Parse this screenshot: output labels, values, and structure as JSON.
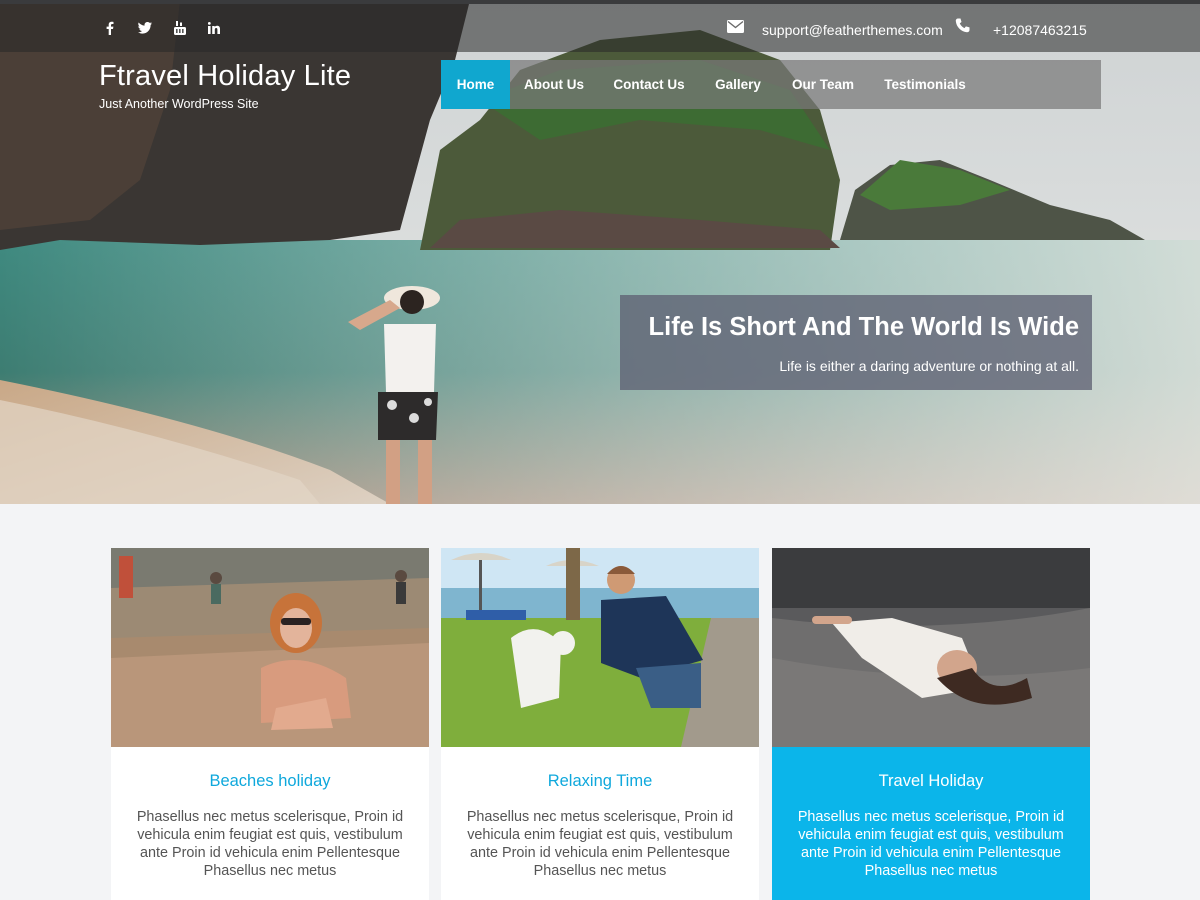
{
  "header": {
    "social": [
      {
        "name": "facebook-icon",
        "glyph": "f"
      },
      {
        "name": "twitter-icon",
        "glyph": "t"
      },
      {
        "name": "youtube-icon",
        "glyph": "yt"
      },
      {
        "name": "linkedin-icon",
        "glyph": "in"
      }
    ],
    "email": "support@featherthemes.com",
    "phone": "+12087463215"
  },
  "site": {
    "title": "Ftravel Holiday Lite",
    "tagline": "Just Another WordPress Site"
  },
  "nav": {
    "items": [
      "Home",
      "About Us",
      "Contact Us",
      "Gallery",
      "Our Team",
      "Testimonials"
    ],
    "active": "Home",
    "accent": "#10a7cf"
  },
  "slider": {
    "title": "Life Is Short And The World Is Wide",
    "subtitle": "Life is either a daring adventure or nothing at all."
  },
  "cards": [
    {
      "title": "Beaches holiday",
      "text": "Phasellus nec metus scelerisque, Proin id vehicula enim feugiat est quis, vestibulum ante Proin id vehicula enim Pellentesque Phasellus nec metus",
      "highlighted": false
    },
    {
      "title": "Relaxing Time",
      "text": "Phasellus nec metus scelerisque, Proin id vehicula enim feugiat est quis, vestibulum ante Proin id vehicula enim Pellentesque Phasellus nec metus",
      "highlighted": false
    },
    {
      "title": "Travel Holiday",
      "text": "Phasellus nec metus scelerisque, Proin id vehicula enim feugiat est quis, vestibulum ante Proin id vehicula enim Pellentesque Phasellus nec metus",
      "highlighted": true
    }
  ],
  "colors": {
    "brand": "#0bb5ea",
    "card_title": "#0fa8dc",
    "page_bg": "#f3f4f6"
  }
}
